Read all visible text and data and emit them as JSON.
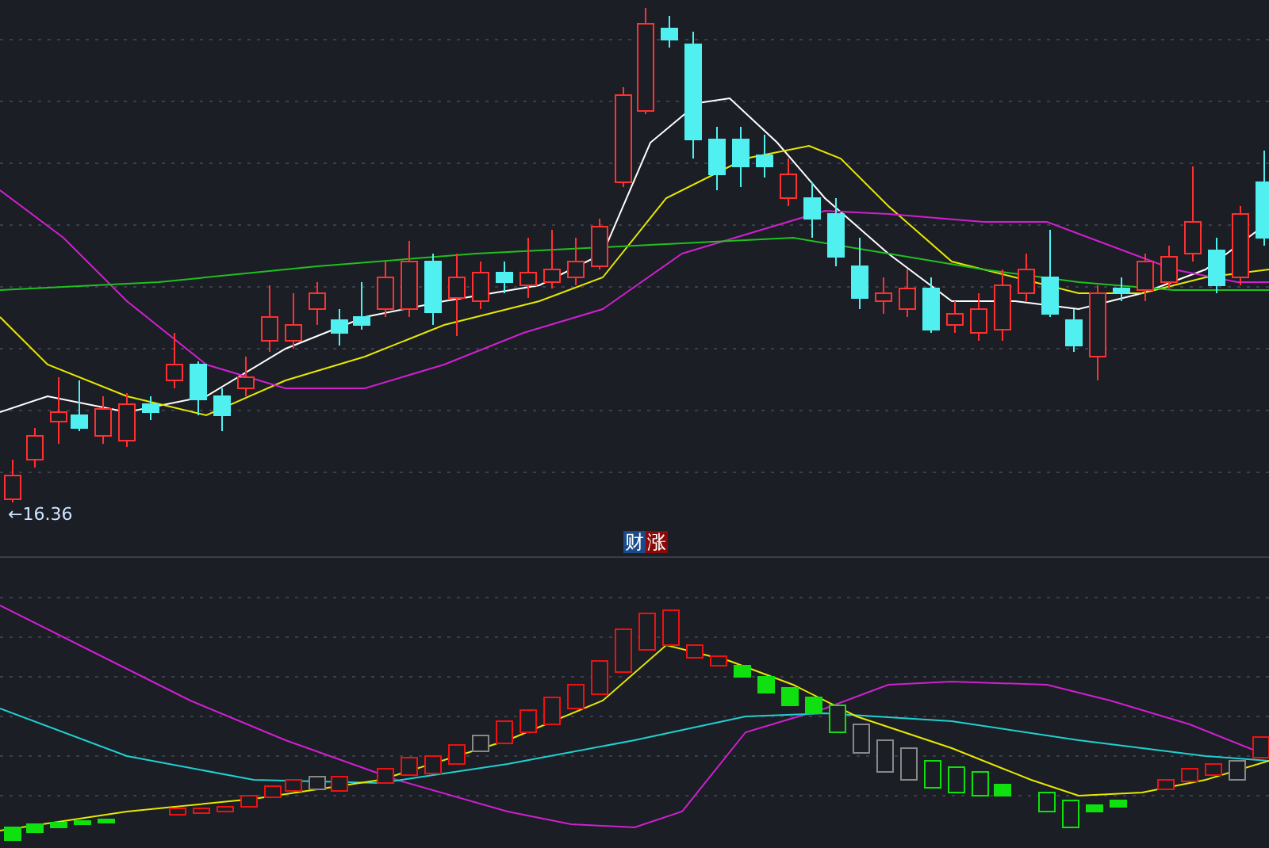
{
  "price_chart": {
    "low_label": "←16.36"
  },
  "indicator": {
    "labels": [
      {
        "text": "财",
        "color": "#1a4a8a"
      },
      {
        "text": "涨",
        "color": "#8a0a0a"
      }
    ]
  }
}
